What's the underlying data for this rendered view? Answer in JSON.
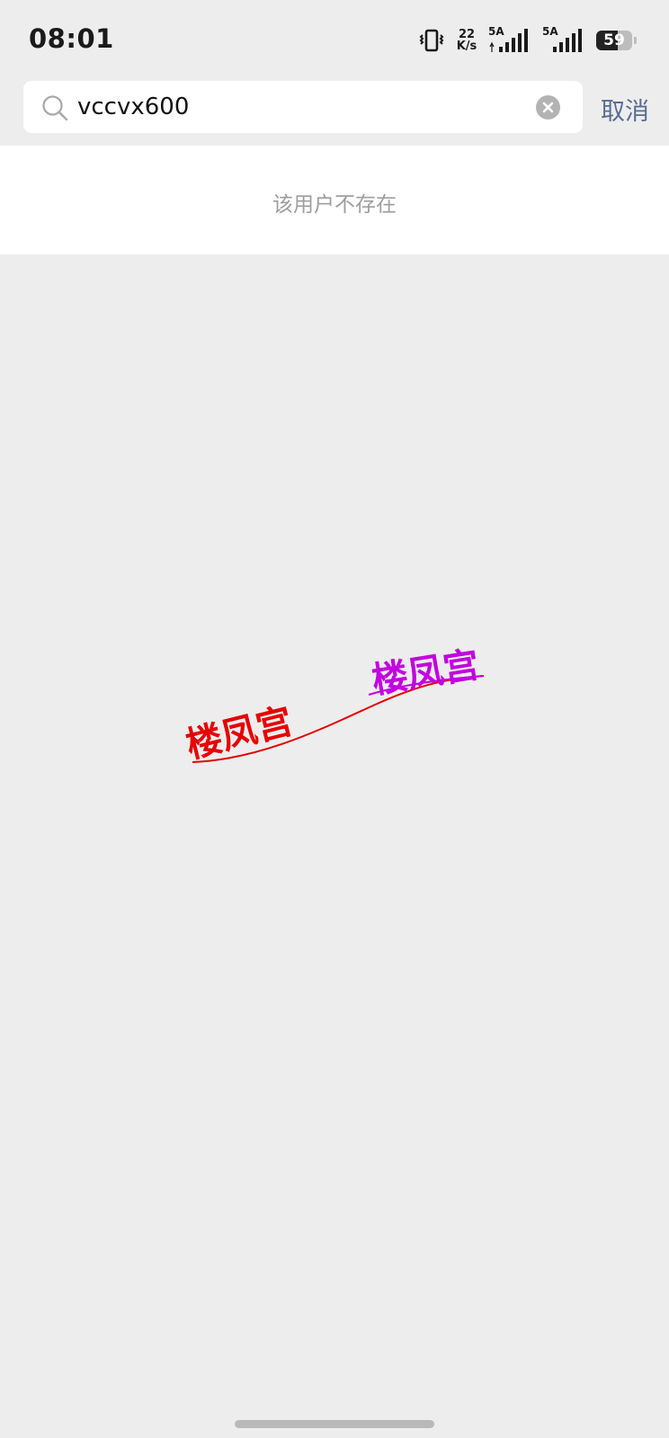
{
  "status_bar": {
    "time": "08:01",
    "net_speed_value": "22",
    "net_speed_unit": "K/s",
    "sim1_label": "5A",
    "sim2_label": "5A",
    "battery_level": "59",
    "battery_fraction": 0.59
  },
  "search": {
    "query": "vccvx600",
    "cancel_label": "取消"
  },
  "result": {
    "message": "该用户不存在"
  },
  "watermark": {
    "text_left": "楼凤宫",
    "text_right": "楼凤宫",
    "color_left": "#e60000",
    "color_right": "#c200e0"
  },
  "colors": {
    "accent_link": "#576b95",
    "background": "#ededed",
    "muted_text": "#9e9e9e"
  }
}
